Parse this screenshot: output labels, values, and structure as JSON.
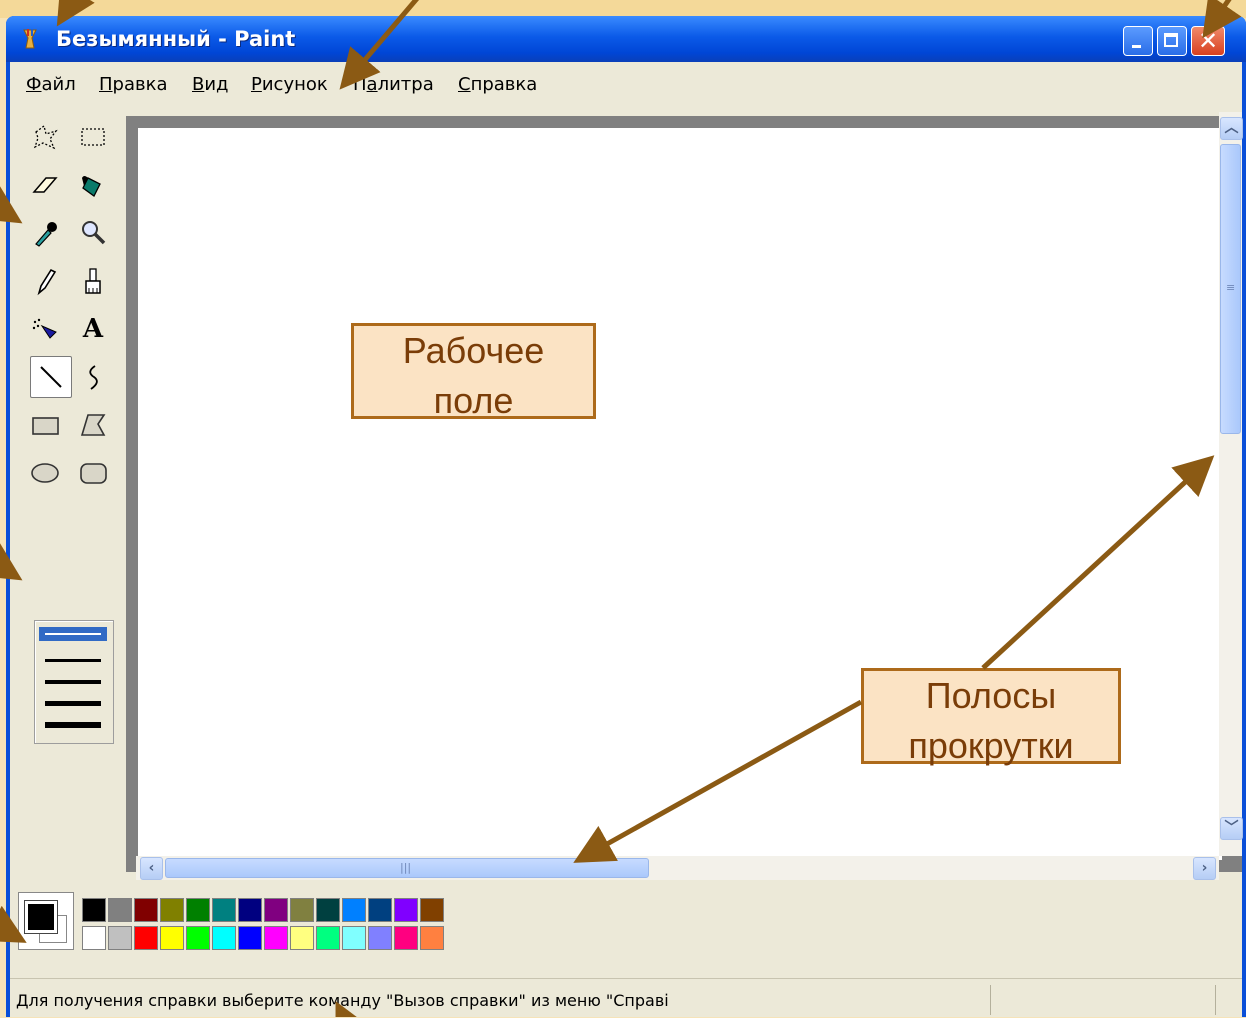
{
  "window": {
    "title": "Безымянный - Paint",
    "close_glyph": "✕"
  },
  "menu": [
    {
      "label_u": "Ф",
      "label_rest": "айл"
    },
    {
      "label_u": "П",
      "label_rest": "равка"
    },
    {
      "label_u": "В",
      "label_rest": "ид"
    },
    {
      "label_u": "Р",
      "label_rest": "исунок"
    },
    {
      "label_pre": "П",
      "label_u": "а",
      "label_rest": "литра"
    },
    {
      "label_u": "С",
      "label_rest": "правка"
    }
  ],
  "tools": [
    "free-form-select-icon",
    "rect-select-icon",
    "eraser-icon",
    "fill-bucket-icon",
    "color-picker-icon",
    "magnifier-icon",
    "pencil-icon",
    "brush-icon",
    "airbrush-icon",
    "text-tool-icon",
    "line-tool-icon",
    "curve-tool-icon",
    "rectangle-tool-icon",
    "polygon-tool-icon",
    "ellipse-tool-icon",
    "rounded-rect-tool-icon"
  ],
  "selected_tool": "line-tool-icon",
  "text_tool_glyph": "A",
  "palette": {
    "top": [
      "#000000",
      "#808080",
      "#800000",
      "#808000",
      "#008000",
      "#008080",
      "#000080",
      "#800080",
      "#808040",
      "#004040",
      "#0080ff",
      "#004080",
      "#8000ff",
      "#804000"
    ],
    "bottom": [
      "#ffffff",
      "#c0c0c0",
      "#ff0000",
      "#ffff00",
      "#00ff00",
      "#00ffff",
      "#0000ff",
      "#ff00ff",
      "#ffff80",
      "#00ff80",
      "#80ffff",
      "#8080ff",
      "#ff0080",
      "#ff8040"
    ],
    "foreground": "#000000",
    "background": "#ffffff"
  },
  "status": {
    "text": "Для получения справки выберите команду \"Вызов справки\" из меню \"Справі"
  },
  "callouts": {
    "work_area": [
      "Рабочее",
      "поле"
    ],
    "scrollbars": [
      "Полосы",
      "прокрутки"
    ]
  },
  "colors": {
    "titlebar": "#0b5ae8",
    "callout_border": "#ad6a1a",
    "callout_fill": "#fbe3c4",
    "arrow": "#8b5a14"
  }
}
